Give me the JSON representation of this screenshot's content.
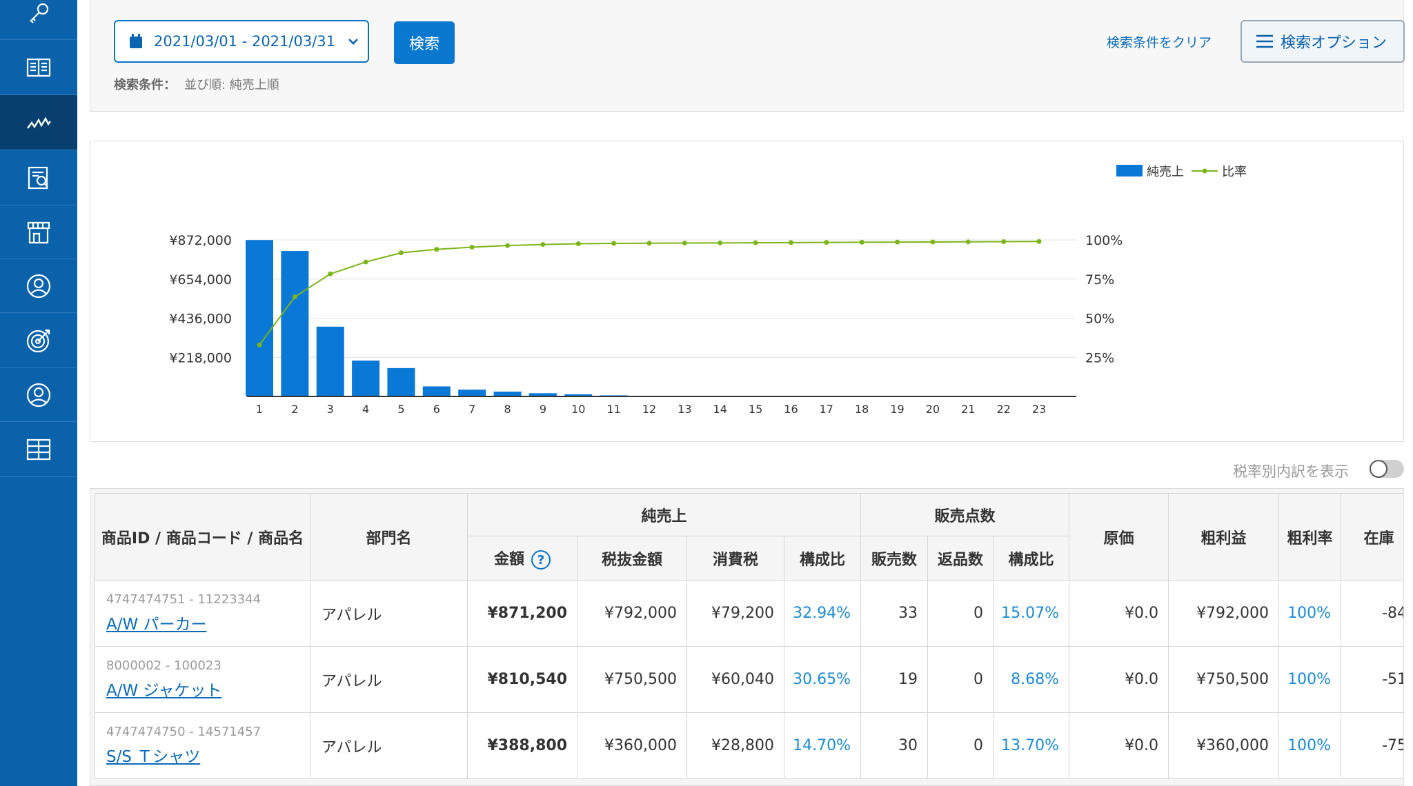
{
  "sidebar": {
    "items": [
      {
        "icon": "key-icon",
        "active": false
      },
      {
        "icon": "book-icon",
        "active": false
      },
      {
        "icon": "trend-icon",
        "active": true
      },
      {
        "icon": "report-icon",
        "active": false
      },
      {
        "icon": "store-icon",
        "active": false
      },
      {
        "icon": "user-icon",
        "active": false
      },
      {
        "icon": "target-icon",
        "active": false
      },
      {
        "icon": "person-icon",
        "active": false
      },
      {
        "icon": "grid-icon",
        "active": false
      }
    ]
  },
  "search": {
    "date_range": "2021/03/01 - 2021/03/31",
    "search_label": "検索",
    "condition_label": "検索条件：",
    "condition_value": "並び順: 純売上順",
    "clear_label": "検索条件をクリア",
    "options_label": "検索オプション"
  },
  "chart_data": {
    "type": "bar",
    "categories": [
      "1",
      "2",
      "3",
      "4",
      "5",
      "6",
      "7",
      "8",
      "9",
      "10",
      "11",
      "12",
      "13",
      "14",
      "15",
      "16",
      "17",
      "18",
      "19",
      "20",
      "21",
      "22",
      "23"
    ],
    "series": [
      {
        "name": "純売上",
        "type": "bar",
        "axis": "left",
        "values": [
          871200,
          810540,
          388800,
          200000,
          158000,
          56000,
          38000,
          27000,
          18000,
          12000,
          6000,
          1500,
          800,
          400,
          200,
          100,
          80,
          60,
          40,
          20,
          10,
          5,
          2
        ]
      },
      {
        "name": "比率",
        "type": "line",
        "axis": "right",
        "values": [
          32.94,
          63.6,
          78.3,
          85.9,
          91.8,
          94.0,
          95.4,
          96.4,
          97.1,
          97.6,
          97.8,
          97.9,
          98.0,
          98.1,
          98.2,
          98.3,
          98.4,
          98.5,
          98.6,
          98.7,
          98.8,
          98.9,
          99.0
        ]
      }
    ],
    "y_left_ticks": [
      "¥872,000",
      "¥654,000",
      "¥436,000",
      "¥218,000"
    ],
    "y_left_tick_values": [
      872000,
      654000,
      436000,
      218000
    ],
    "y_left_max": 872000,
    "y_right_ticks": [
      "100%",
      "75%",
      "50%",
      "25%"
    ],
    "y_right_tick_values": [
      100,
      75,
      50,
      25
    ],
    "bar_color": "#0a78d7",
    "line_color": "#7cb518",
    "grid": true,
    "legend_position": "top-right"
  },
  "toggle": {
    "label": "税率別内訳を表示",
    "on": false
  },
  "table": {
    "headers": {
      "product": "商品ID / 商品コード / 商品名",
      "dept": "部門名",
      "net_sales": "純売上",
      "qty": "販売点数",
      "cost": "原価",
      "gross_profit": "粗利益",
      "gross_rate": "粗利率",
      "stock": "在庫",
      "amount": "金額",
      "tax_excl": "税抜金額",
      "tax": "消費税",
      "share": "構成比",
      "sold": "販売数",
      "returned": "返品数",
      "qty_share": "構成比"
    },
    "rows": [
      {
        "id": "4747474751 - 11223344",
        "name": "A/W パーカー",
        "dept": "アパレル",
        "amount": "¥871,200",
        "tax_excl": "¥792,000",
        "tax": "¥79,200",
        "share": "32.94%",
        "sold": "33",
        "returned": "0",
        "qty_share": "15.07%",
        "cost": "¥0.0",
        "gross_profit": "¥792,000",
        "gross_rate": "100%",
        "stock": "-84"
      },
      {
        "id": "8000002 - 100023",
        "name": "A/W ジャケット",
        "dept": "アパレル",
        "amount": "¥810,540",
        "tax_excl": "¥750,500",
        "tax": "¥60,040",
        "share": "30.65%",
        "sold": "19",
        "returned": "0",
        "qty_share": "8.68%",
        "cost": "¥0.0",
        "gross_profit": "¥750,500",
        "gross_rate": "100%",
        "stock": "-51"
      },
      {
        "id": "4747474750 - 14571457",
        "name": "S/S Ｔシャツ",
        "dept": "アパレル",
        "amount": "¥388,800",
        "tax_excl": "¥360,000",
        "tax": "¥28,800",
        "share": "14.70%",
        "sold": "30",
        "returned": "0",
        "qty_share": "13.70%",
        "cost": "¥0.0",
        "gross_profit": "¥360,000",
        "gross_rate": "100%",
        "stock": "-75"
      }
    ]
  }
}
